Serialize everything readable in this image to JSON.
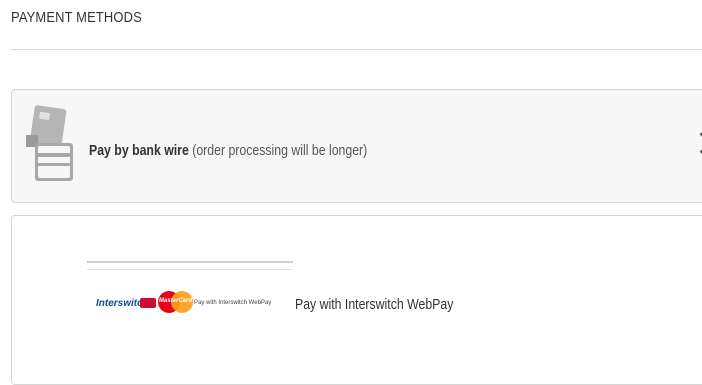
{
  "section": {
    "title": "PAYMENT METHODS"
  },
  "bankwire": {
    "label_bold": "Pay by bank wire",
    "label_note": " (order processing will be longer)",
    "icon": "bank-card-icon",
    "chevron_icon": "chevron-right-icon"
  },
  "webpay": {
    "logo_text_brand": "Interswitch",
    "logo_text_mc": "MasterCard",
    "logo_caption": "Pay with Interswitch WebPay",
    "label": "Pay with Interswitch WebPay",
    "colors": {
      "mc_red": "#eb001b",
      "mc_yellow": "#f79e1b",
      "isw_blue": "#0f4d8c",
      "isw_red": "#c8102e"
    }
  }
}
